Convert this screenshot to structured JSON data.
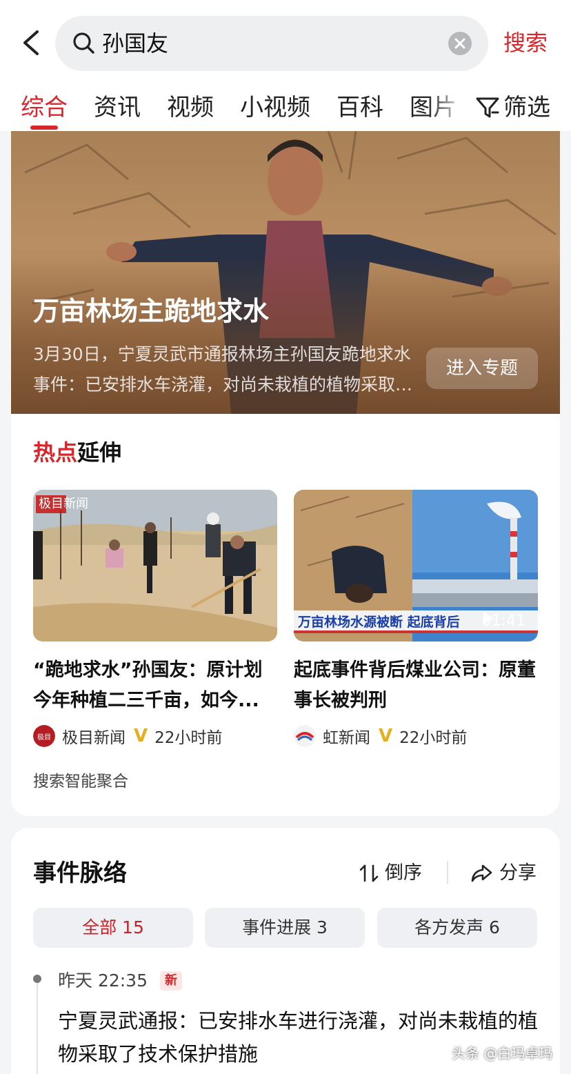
{
  "search": {
    "query": "孙国友",
    "button_label": "搜索"
  },
  "tabs": [
    {
      "label": "综合",
      "active": true
    },
    {
      "label": "资讯"
    },
    {
      "label": "视频"
    },
    {
      "label": "小视频"
    },
    {
      "label": "百科"
    },
    {
      "label": "图片"
    }
  ],
  "filter": {
    "label": "筛选"
  },
  "hero": {
    "title": "万亩林场主跪地求水",
    "summary": "3月30日，宁夏灵武市通报林场主孙国友跪地求水事件：已安排水车浇灌，对尚未栽植的植物采取了技术保护措施",
    "topic_button": "进入专题"
  },
  "hot_extension": {
    "title_hot": "热点",
    "title_rest": "延伸",
    "items": [
      {
        "thumb_logo_a": "极目",
        "thumb_logo_b": "新闻",
        "title": "“跪地求水”孙国友：原计划今年种植二三千亩，如今...",
        "source": "极目新闻",
        "time": "22小时前"
      },
      {
        "overlay_caption": "万亩林场水源被断 起底背后",
        "duration": "01:41",
        "title": "起底事件背后煤业公司：原董事长被判刑",
        "source": "虹新闻",
        "time": "22小时前"
      }
    ],
    "aggregate_note": "搜索智能聚合"
  },
  "timeline": {
    "title": "事件脉络",
    "sort_label": "倒序",
    "share_label": "分享",
    "filters": [
      {
        "label": "全部 15",
        "active": true
      },
      {
        "label": "事件进展 3"
      },
      {
        "label": "各方发声 6"
      }
    ],
    "entries": [
      {
        "time": "昨天 22:35",
        "badge": "新",
        "title": "宁夏灵武通报：已安排水车进行浇灌，对尚未栽植的植物采取了技术保护措施"
      }
    ]
  },
  "watermark": "头条 @白玛卓玛",
  "colors": {
    "accent_red": "#d8262a",
    "verified_gold": "#e3b021",
    "pill_bg": "#eef0f3",
    "page_bg": "#f4f5f7"
  },
  "icons": [
    "back-icon",
    "search-icon",
    "clear-icon",
    "filter-icon",
    "play-icon",
    "verified-icon",
    "sort-icon",
    "share-icon"
  ]
}
